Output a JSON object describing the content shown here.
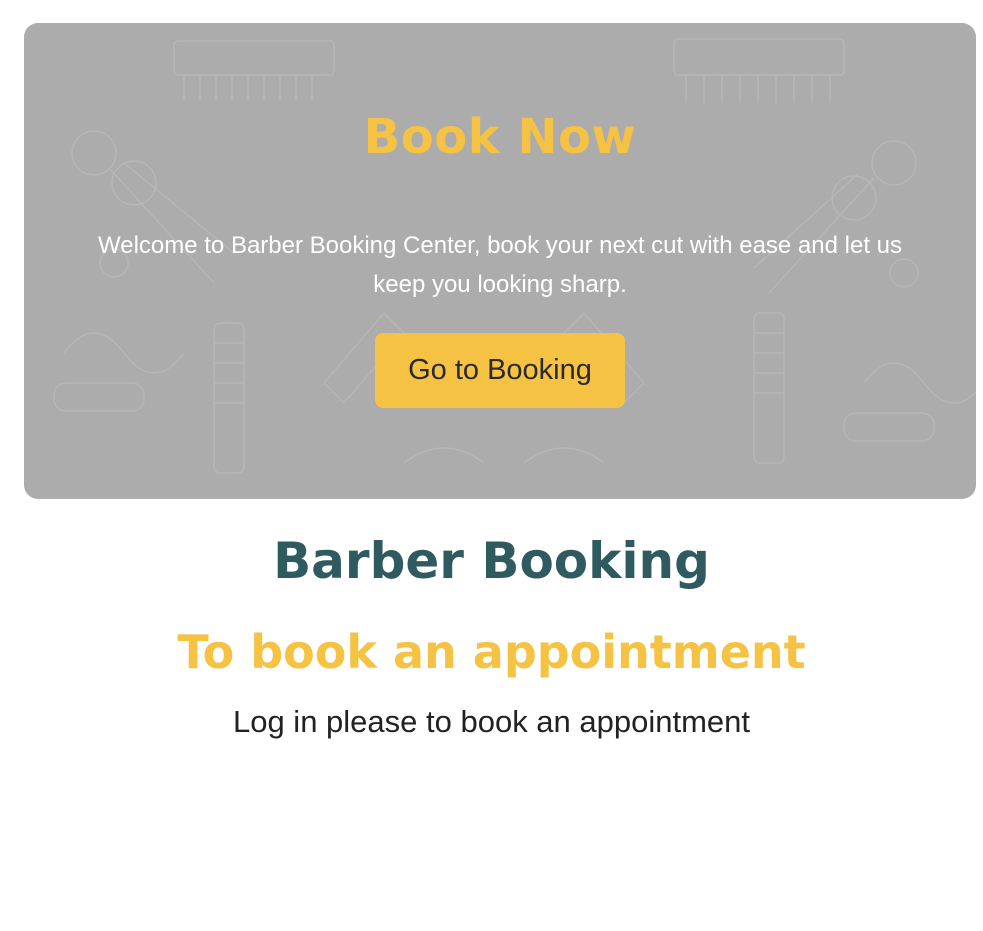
{
  "hero": {
    "title": "Book Now",
    "description": "Welcome to Barber Booking Center, book your next cut with ease and let us keep you looking sharp.",
    "button_label": "Go to Booking",
    "background_pattern": "barber-tools-pattern"
  },
  "main": {
    "brand_title": "Barber Booking",
    "section_title": "To book an appointment",
    "login_note": "Log in please to book an appointment"
  },
  "colors": {
    "accent": "#f5c244",
    "brand": "#2f5a60",
    "hero_background": "#adacac",
    "text": "#222222"
  }
}
